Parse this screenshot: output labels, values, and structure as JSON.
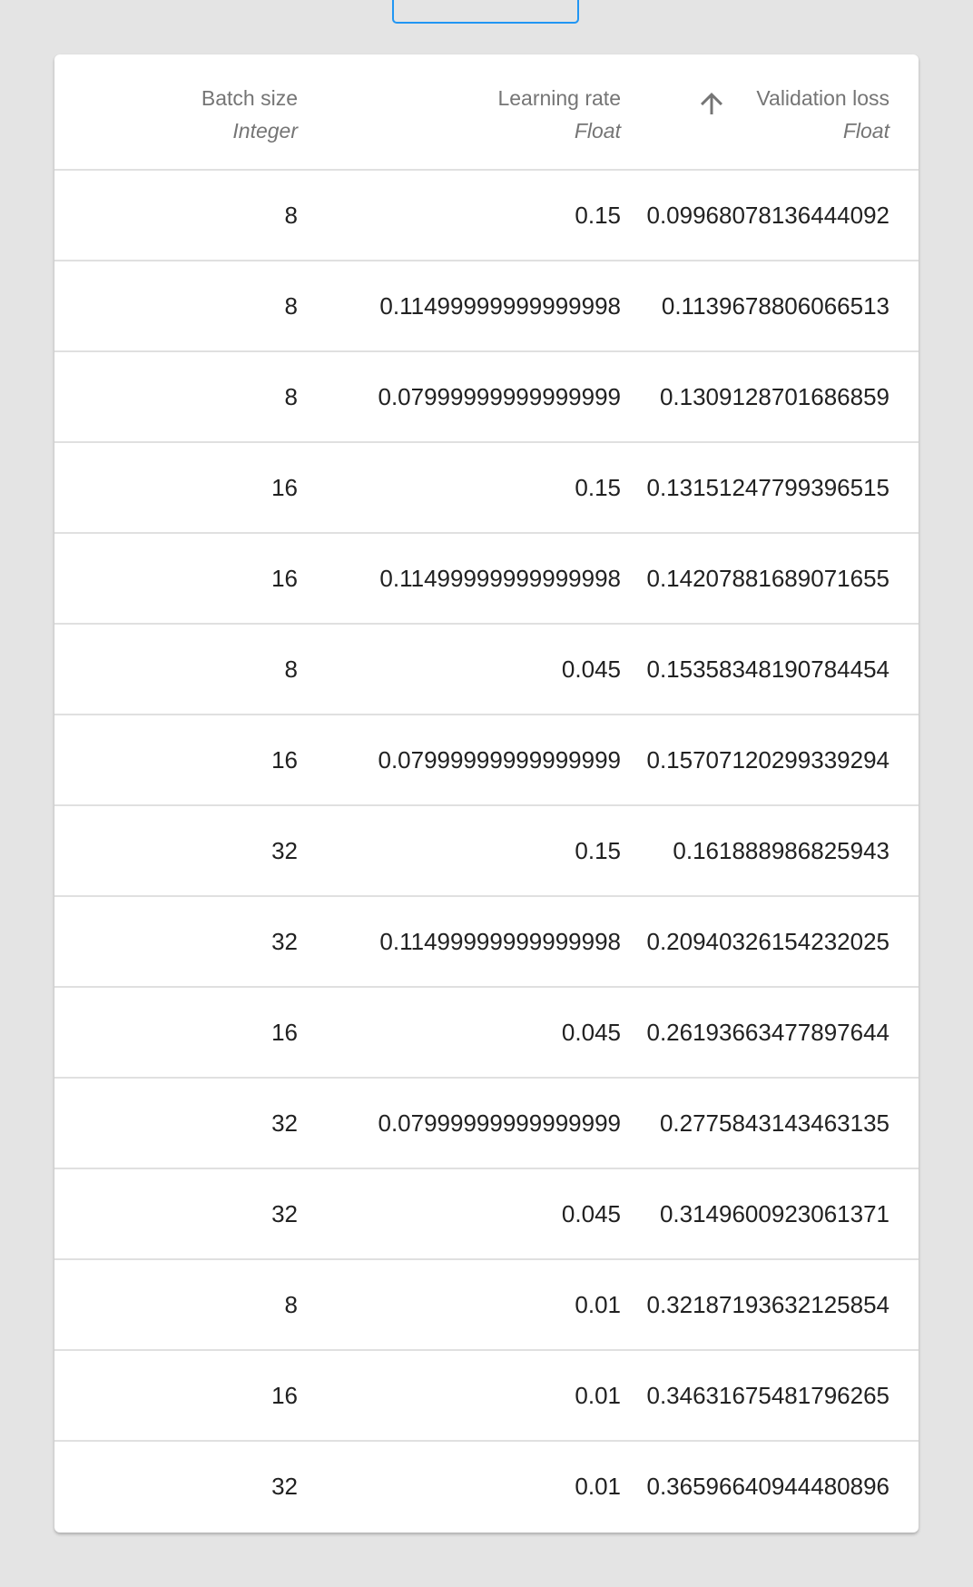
{
  "columns": [
    {
      "label": "Batch size",
      "type": "Integer"
    },
    {
      "label": "Learning rate",
      "type": "Float"
    },
    {
      "label": "Validation loss",
      "type": "Float",
      "sort": "ascending"
    }
  ],
  "rows": [
    [
      "8",
      "0.15",
      "0.09968078136444092"
    ],
    [
      "8",
      "0.11499999999999998",
      "0.1139678806066513"
    ],
    [
      "8",
      "0.07999999999999999",
      "0.1309128701686859"
    ],
    [
      "16",
      "0.15",
      "0.13151247799396515"
    ],
    [
      "16",
      "0.11499999999999998",
      "0.14207881689071655"
    ],
    [
      "8",
      "0.045",
      "0.15358348190784454"
    ],
    [
      "16",
      "0.07999999999999999",
      "0.15707120299339294"
    ],
    [
      "32",
      "0.15",
      "0.161888986825943"
    ],
    [
      "32",
      "0.11499999999999998",
      "0.20940326154232025"
    ],
    [
      "16",
      "0.045",
      "0.26193663477897644"
    ],
    [
      "32",
      "0.07999999999999999",
      "0.2775843143463135"
    ],
    [
      "32",
      "0.045",
      "0.3149600923061371"
    ],
    [
      "8",
      "0.01",
      "0.32187193632125854"
    ],
    [
      "16",
      "0.01",
      "0.34631675481796265"
    ],
    [
      "32",
      "0.01",
      "0.36596640944480896"
    ]
  ],
  "colors": {
    "accent": "#2196f3",
    "header_text": "#757575",
    "cell_text": "#212121"
  }
}
